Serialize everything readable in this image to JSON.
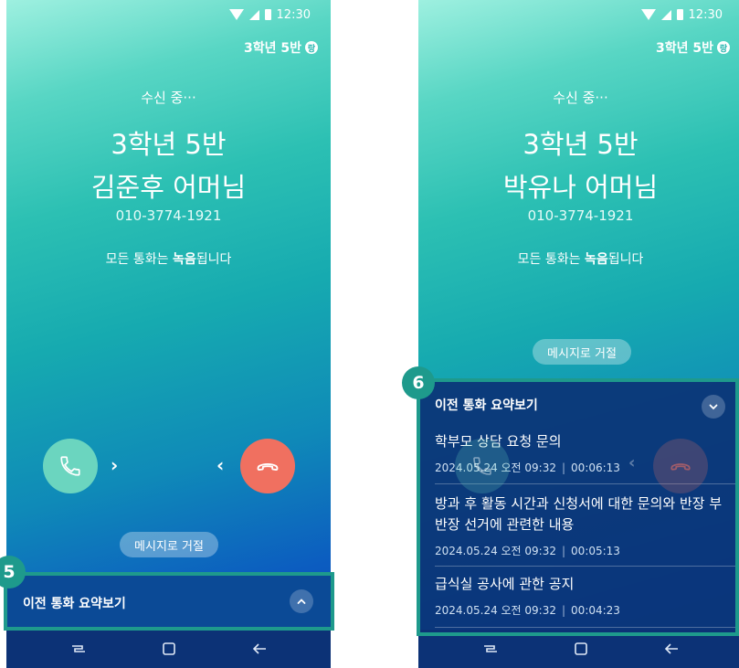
{
  "status": {
    "time": "12:30"
  },
  "class_label": "3학년 5반",
  "class_badge": "랑",
  "screen_a": {
    "incoming": "수신 중···",
    "class_name": "3학년 5반",
    "caller": "김준후 어머님",
    "phone": "010-3774-1921",
    "notice_pre": "모든 통화는 ",
    "notice_bold": "녹음",
    "notice_post": "됩니다",
    "reject_msg": "메시지로 거절",
    "summary_title": "이전 통화 요약보기",
    "step": "5"
  },
  "screen_b": {
    "incoming": "수신 중···",
    "class_name": "3학년 5반",
    "caller": "박유나 어머님",
    "phone": "010-3774-1921",
    "notice_pre": "모든 통화는 ",
    "notice_bold": "녹음",
    "notice_post": "됩니다",
    "reject_msg": "메시지로 거절",
    "summary_title": "이전 통화 요약보기",
    "step": "6",
    "records": [
      {
        "title": "학부모 상담 요청 문의",
        "date": "2024.05.24 오전 09:32",
        "duration": "00:06:13"
      },
      {
        "title": "방과 후 활동 시간과 신청서에 대한 문의와 반장 부반장 선거에 관련한 내용",
        "date": "2024.05.24 오전 09:32",
        "duration": "00:05:13"
      },
      {
        "title": "급식실 공사에 관한 공지",
        "date": "2024.05.24 오전 09:32",
        "duration": "00:04:23"
      }
    ]
  },
  "icons": {
    "accept": "phone-icon",
    "decline": "hang-up-icon",
    "expand": "chevron-up-icon",
    "collapse": "chevron-down-icon",
    "nav_recent": "recent-apps-icon",
    "nav_home": "home-icon",
    "nav_back": "back-icon"
  },
  "colors": {
    "accept": "#6bd5bf",
    "decline": "#f07060",
    "highlight": "#1e9a8c",
    "panel": "#0b3476"
  }
}
